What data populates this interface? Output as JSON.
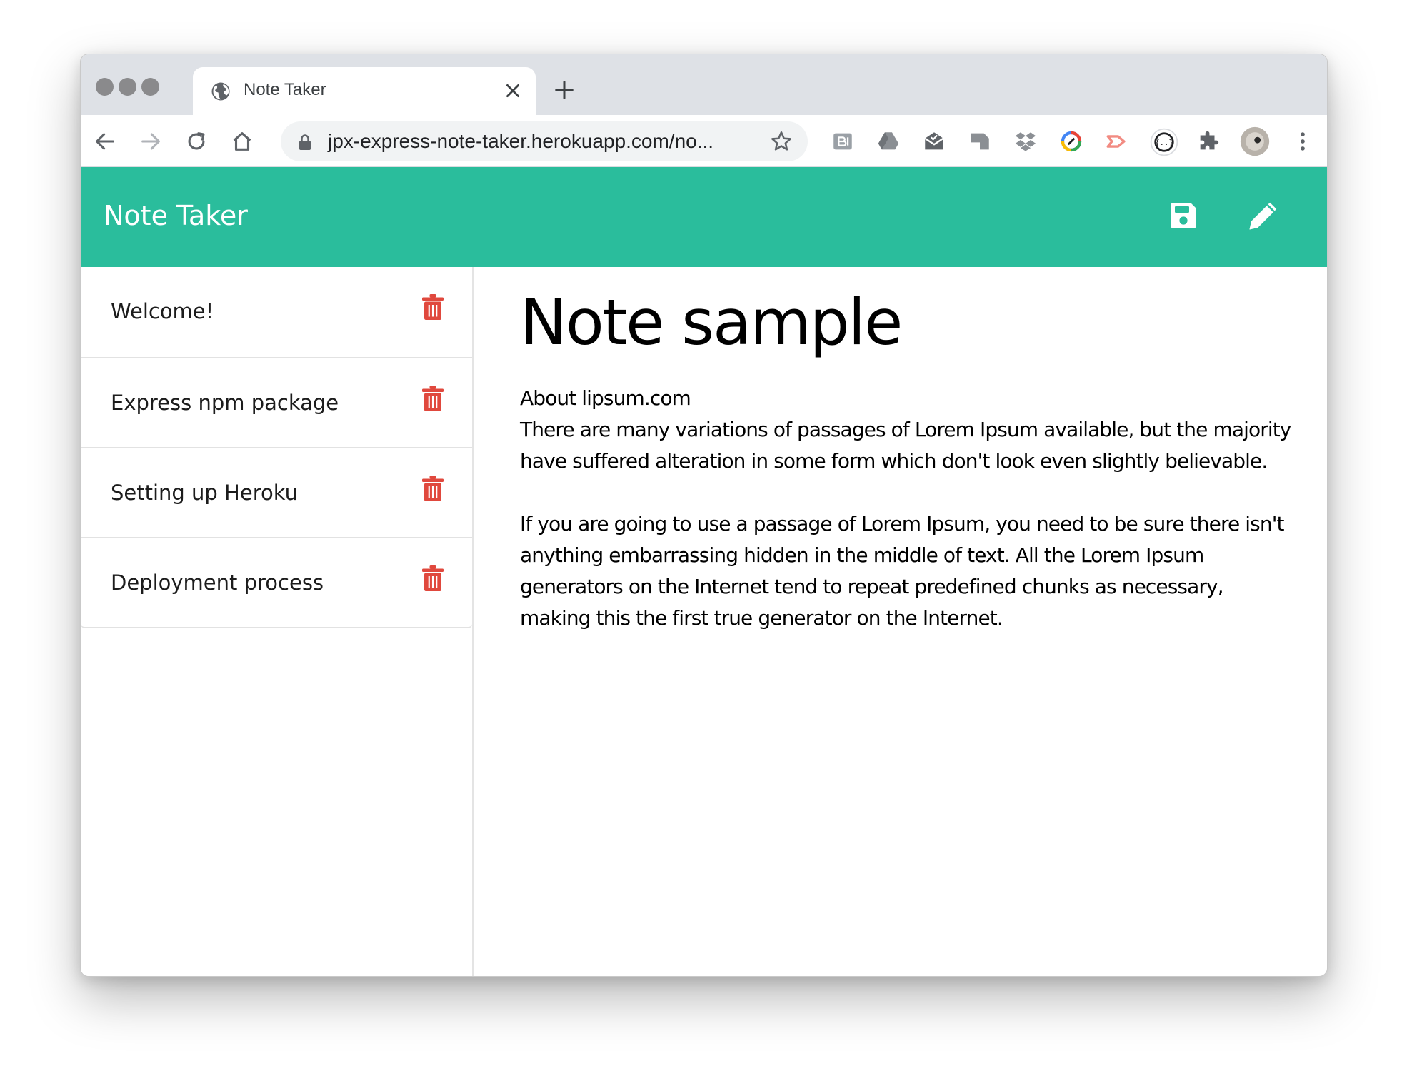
{
  "browser": {
    "tab_title": "Note Taker",
    "url": "jpx-express-note-taker.herokuapp.com/no..."
  },
  "app": {
    "brand": "Note Taker",
    "accent_color": "#2abd9c",
    "delete_color": "#e0483d"
  },
  "notes": [
    {
      "title": "Welcome!"
    },
    {
      "title": "Express npm package"
    },
    {
      "title": "Setting up Heroku"
    },
    {
      "title": "Deployment process"
    }
  ],
  "active_note": {
    "title": "Note sample",
    "text": "About lipsum.com\nThere are many variations of passages of Lorem Ipsum available, but the majority have suffered alteration in some form which don't look even slightly believable.\n\nIf you are going to use a passage of Lorem Ipsum, you need to be sure there isn't anything embarrassing hidden in the middle of text. All the Lorem Ipsum generators on the Internet tend to repeat predefined chunks as necessary, making this the first true generator on the Internet."
  }
}
